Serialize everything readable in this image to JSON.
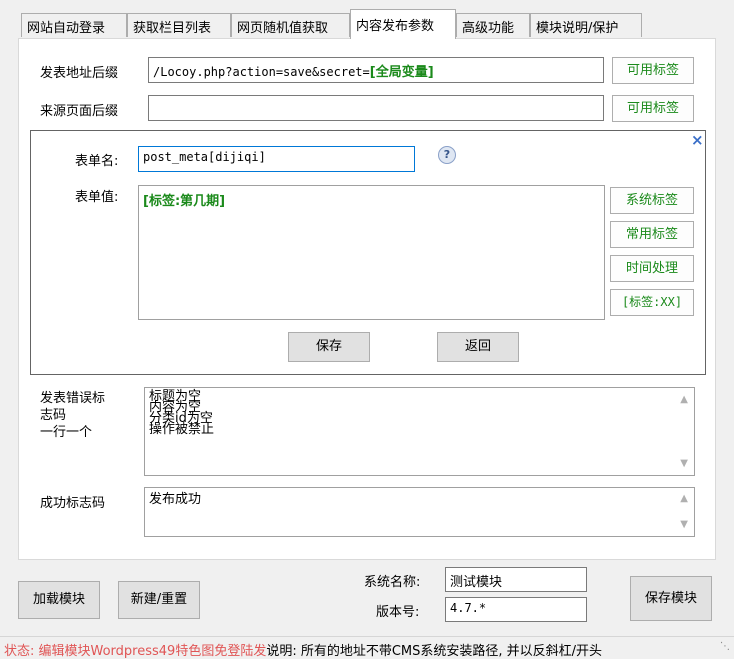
{
  "tabs": [
    {
      "label": "网站自动登录",
      "active": false
    },
    {
      "label": "获取栏目列表",
      "active": false
    },
    {
      "label": "网页随机值获取",
      "active": false
    },
    {
      "label": "内容发布参数",
      "active": true
    },
    {
      "label": "高级功能",
      "active": false
    },
    {
      "label": "模块说明/保护",
      "active": false
    }
  ],
  "publish_url": {
    "label": "发表地址后缀",
    "value_prefix": "/Locoy.php?action=save&secret=",
    "value_tag": "[全局变量]",
    "tag_button": "可用标签"
  },
  "source_page": {
    "label": "来源页面后缀",
    "value": "",
    "tag_button": "可用标签"
  },
  "form_editor": {
    "close_glyph": "×",
    "form_name_label": "表单名:",
    "form_name_value": "post_meta[dijiqi]",
    "help_glyph": "?",
    "form_value_label": "表单值:",
    "form_value": "[标签:第几期]",
    "side_buttons": [
      "系统标签",
      "常用标签",
      "时间处理",
      "[标签:XX]"
    ],
    "save_button": "保存",
    "back_button": "返回"
  },
  "error_codes": {
    "label_lines": [
      "发表错误标",
      "志码",
      "一行一个"
    ],
    "lines": [
      "标题为空",
      "内容为空",
      "分类id为空",
      "操作被禁止"
    ]
  },
  "success_code": {
    "label": "成功标志码",
    "value": "发布成功"
  },
  "bottom": {
    "load_button": "加载模块",
    "new_button": "新建/重置",
    "system_name_label": "系统名称:",
    "system_name_value": "测试模块",
    "version_label": "版本号:",
    "version_value": "4.7.*",
    "save_module_button": "保存模块"
  },
  "status_bar": {
    "status_text": "状态: 编辑模块Wordpress49特色图免登陆发",
    "note_text": "说明: 所有的地址不带CMS系统安装路径, 并以反斜杠/开头"
  },
  "colors": {
    "tag_green": "#1b8a1b",
    "status_red": "#e05555"
  }
}
